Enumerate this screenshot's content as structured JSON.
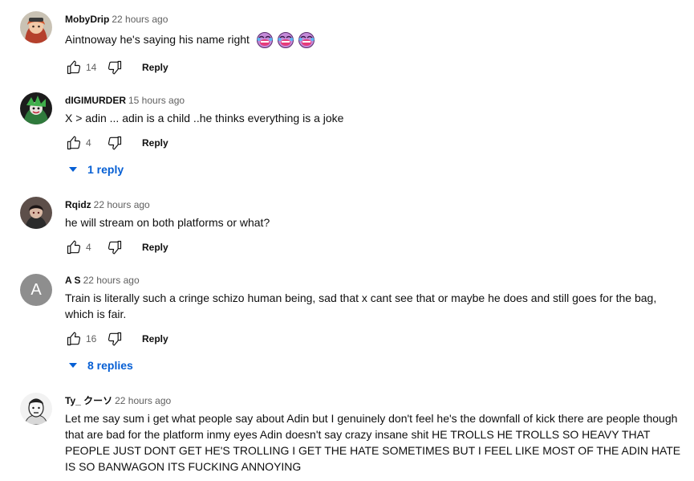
{
  "comments": [
    {
      "author": "MobyDrip",
      "time": "22 hours ago",
      "text": "Aintnoway he's saying his name right",
      "emoji": [
        "skull-laughing-emoji",
        "skull-laughing-emoji",
        "skull-laughing-emoji"
      ],
      "likes": "14",
      "reply_label": "Reply"
    },
    {
      "author": "dIGIMURDER",
      "time": "15 hours ago",
      "text": "X > adin ... adin is a child ..he thinks everything is a joke",
      "likes": "4",
      "reply_label": "Reply",
      "replies_label": "1 reply"
    },
    {
      "author": "Rqidz",
      "time": "22 hours ago",
      "text": "he will stream on both platforms or what?",
      "likes": "4",
      "reply_label": "Reply"
    },
    {
      "author": "A S",
      "avatar_letter": "A",
      "time": "22 hours ago",
      "text": "Train is literally such a cringe schizo human being, sad that x cant see that or maybe he does and still goes for the bag, which is fair.",
      "likes": "16",
      "reply_label": "Reply",
      "replies_label": "8 replies"
    },
    {
      "author": "Ty_ クーソ",
      "time": "22 hours ago",
      "text": "Let me say sum i get what people say about Adin but I genuinely don't feel he's the downfall of kick there are people though that are bad for the platform inmy eyes Adin doesn't say crazy insane shit HE TROLLS HE TROLLS SO HEAVY THAT PEOPLE JUST DONT GET HE'S TROLLING I GET THE HATE SOMETIMES BUT I FEEL LIKE MOST OF THE ADIN HATE IS SO BANWAGON ITS FUCKING ANNOYING"
    }
  ],
  "colors": {
    "link_blue": "#065fd4",
    "meta_gray": "#606060",
    "avatar_as_bg": "#8e8e8e"
  }
}
